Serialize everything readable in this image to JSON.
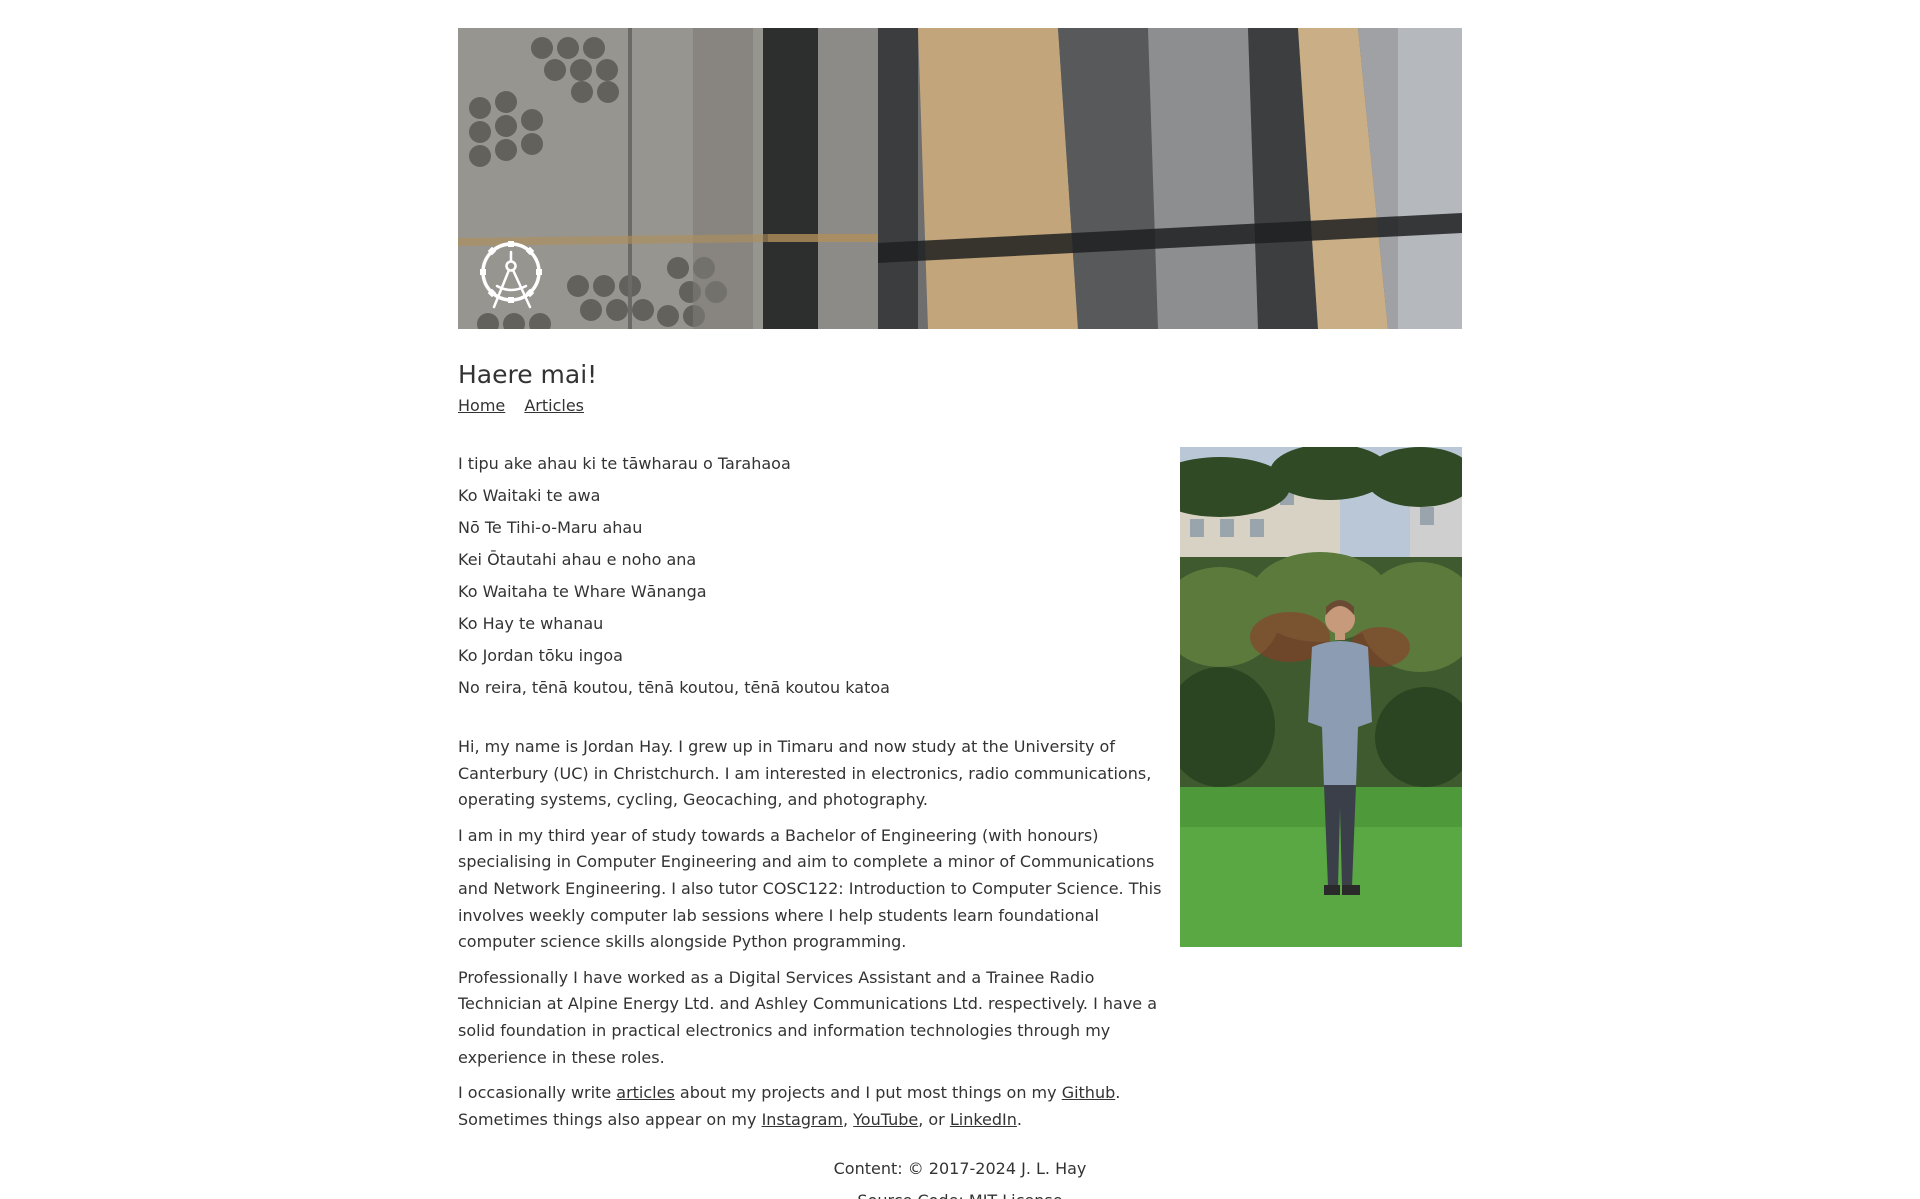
{
  "header": {
    "logo_icon": "compass-gear-icon"
  },
  "page_title": "Haere mai!",
  "nav": {
    "home": "Home",
    "articles": "Articles"
  },
  "pepeha": [
    "I tipu ake ahau ki te tāwharau o Tarahaoa",
    "Ko Waitaki te awa",
    "Nō Te Tihi-o-Maru ahau",
    "Kei Ōtautahi ahau e noho ana",
    "Ko Waitaha te Whare Wānanga",
    "Ko Hay te whanau",
    "Ko Jordan tōku ingoa",
    "No reira, tēnā koutou, tēnā koutou, tēnā koutou katoa"
  ],
  "bio": {
    "p1": "Hi, my name is Jordan Hay. I grew up in Timaru and now study at the University of Canterbury (UC) in Christchurch. I am interested in electronics, radio communications, operating systems, cycling, Geocaching, and photography.",
    "p2": "I am in my third year of study towards a Bachelor of Engineering (with honours) specialising in Computer Engineering and aim to complete a minor of Communications and Network Engineering. I also tutor COSC122: Introduction to Computer Science. This involves weekly computer lab sessions where I help students learn foundational computer science skills alongside Python programming.",
    "p3": "Professionally I have worked as a Digital Services Assistant and a Trainee Radio Technician at Alpine Energy Ltd. and Ashley Communications Ltd. respectively. I have a solid foundation in practical electronics and information technologies through my experience in these roles.",
    "p4_before_articles": "I occasionally write ",
    "p4_articles_link": "articles",
    "p4_after_articles": " about my projects and I put most things on my ",
    "p4_github_link": "Github",
    "p4_after_github": ". Sometimes things also appear on my ",
    "p4_instagram_link": "Instagram",
    "p4_comma1": ", ",
    "p4_youtube_link": "YouTube",
    "p4_or": ", or ",
    "p4_linkedin_link": "LinkedIn",
    "p4_end": "."
  },
  "footer": {
    "content_license": "Content: © 2017-2024 J. L. Hay",
    "source_license": "Source Code: MIT License"
  }
}
